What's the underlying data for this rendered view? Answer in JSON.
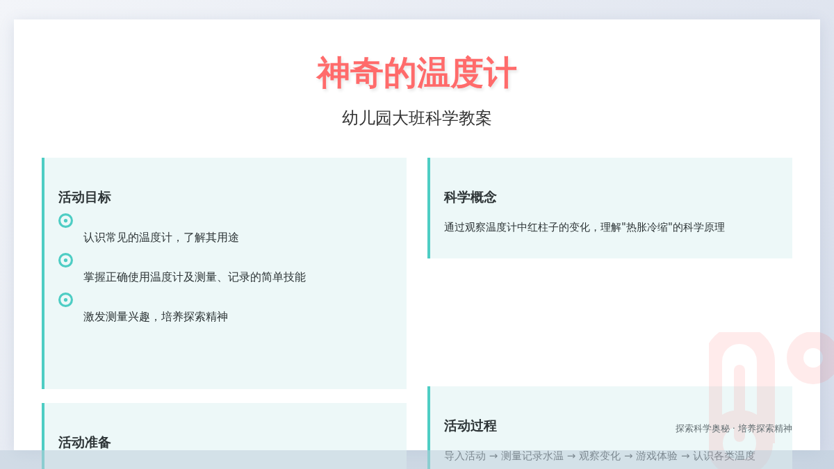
{
  "title": "神奇的温度计",
  "subtitle": "幼儿园大班科学教案",
  "left_sections": [
    {
      "kind": "list",
      "heading": "活动目标",
      "items": [
        "认识常见的温度计，了解其用途",
        "掌握正确使用温度计及测量、记录的简单技能",
        "激发测量兴趣，培养探索精神"
      ]
    },
    {
      "kind": "text",
      "heading": "活动准备"
    }
  ],
  "right_sections": [
    {
      "kind": "text",
      "heading": "科学概念",
      "text": "通过观察温度计中红柱子的变化，理解\"热胀冷缩\"的科学原理"
    },
    {
      "kind": "text",
      "heading": "活动过程",
      "text": "导入活动 → 测量记录水温 → 观察变化 → 游戏体验 → 认识各类温度"
    }
  ],
  "footer": "探索科学奥秘 · 培养探索精神"
}
